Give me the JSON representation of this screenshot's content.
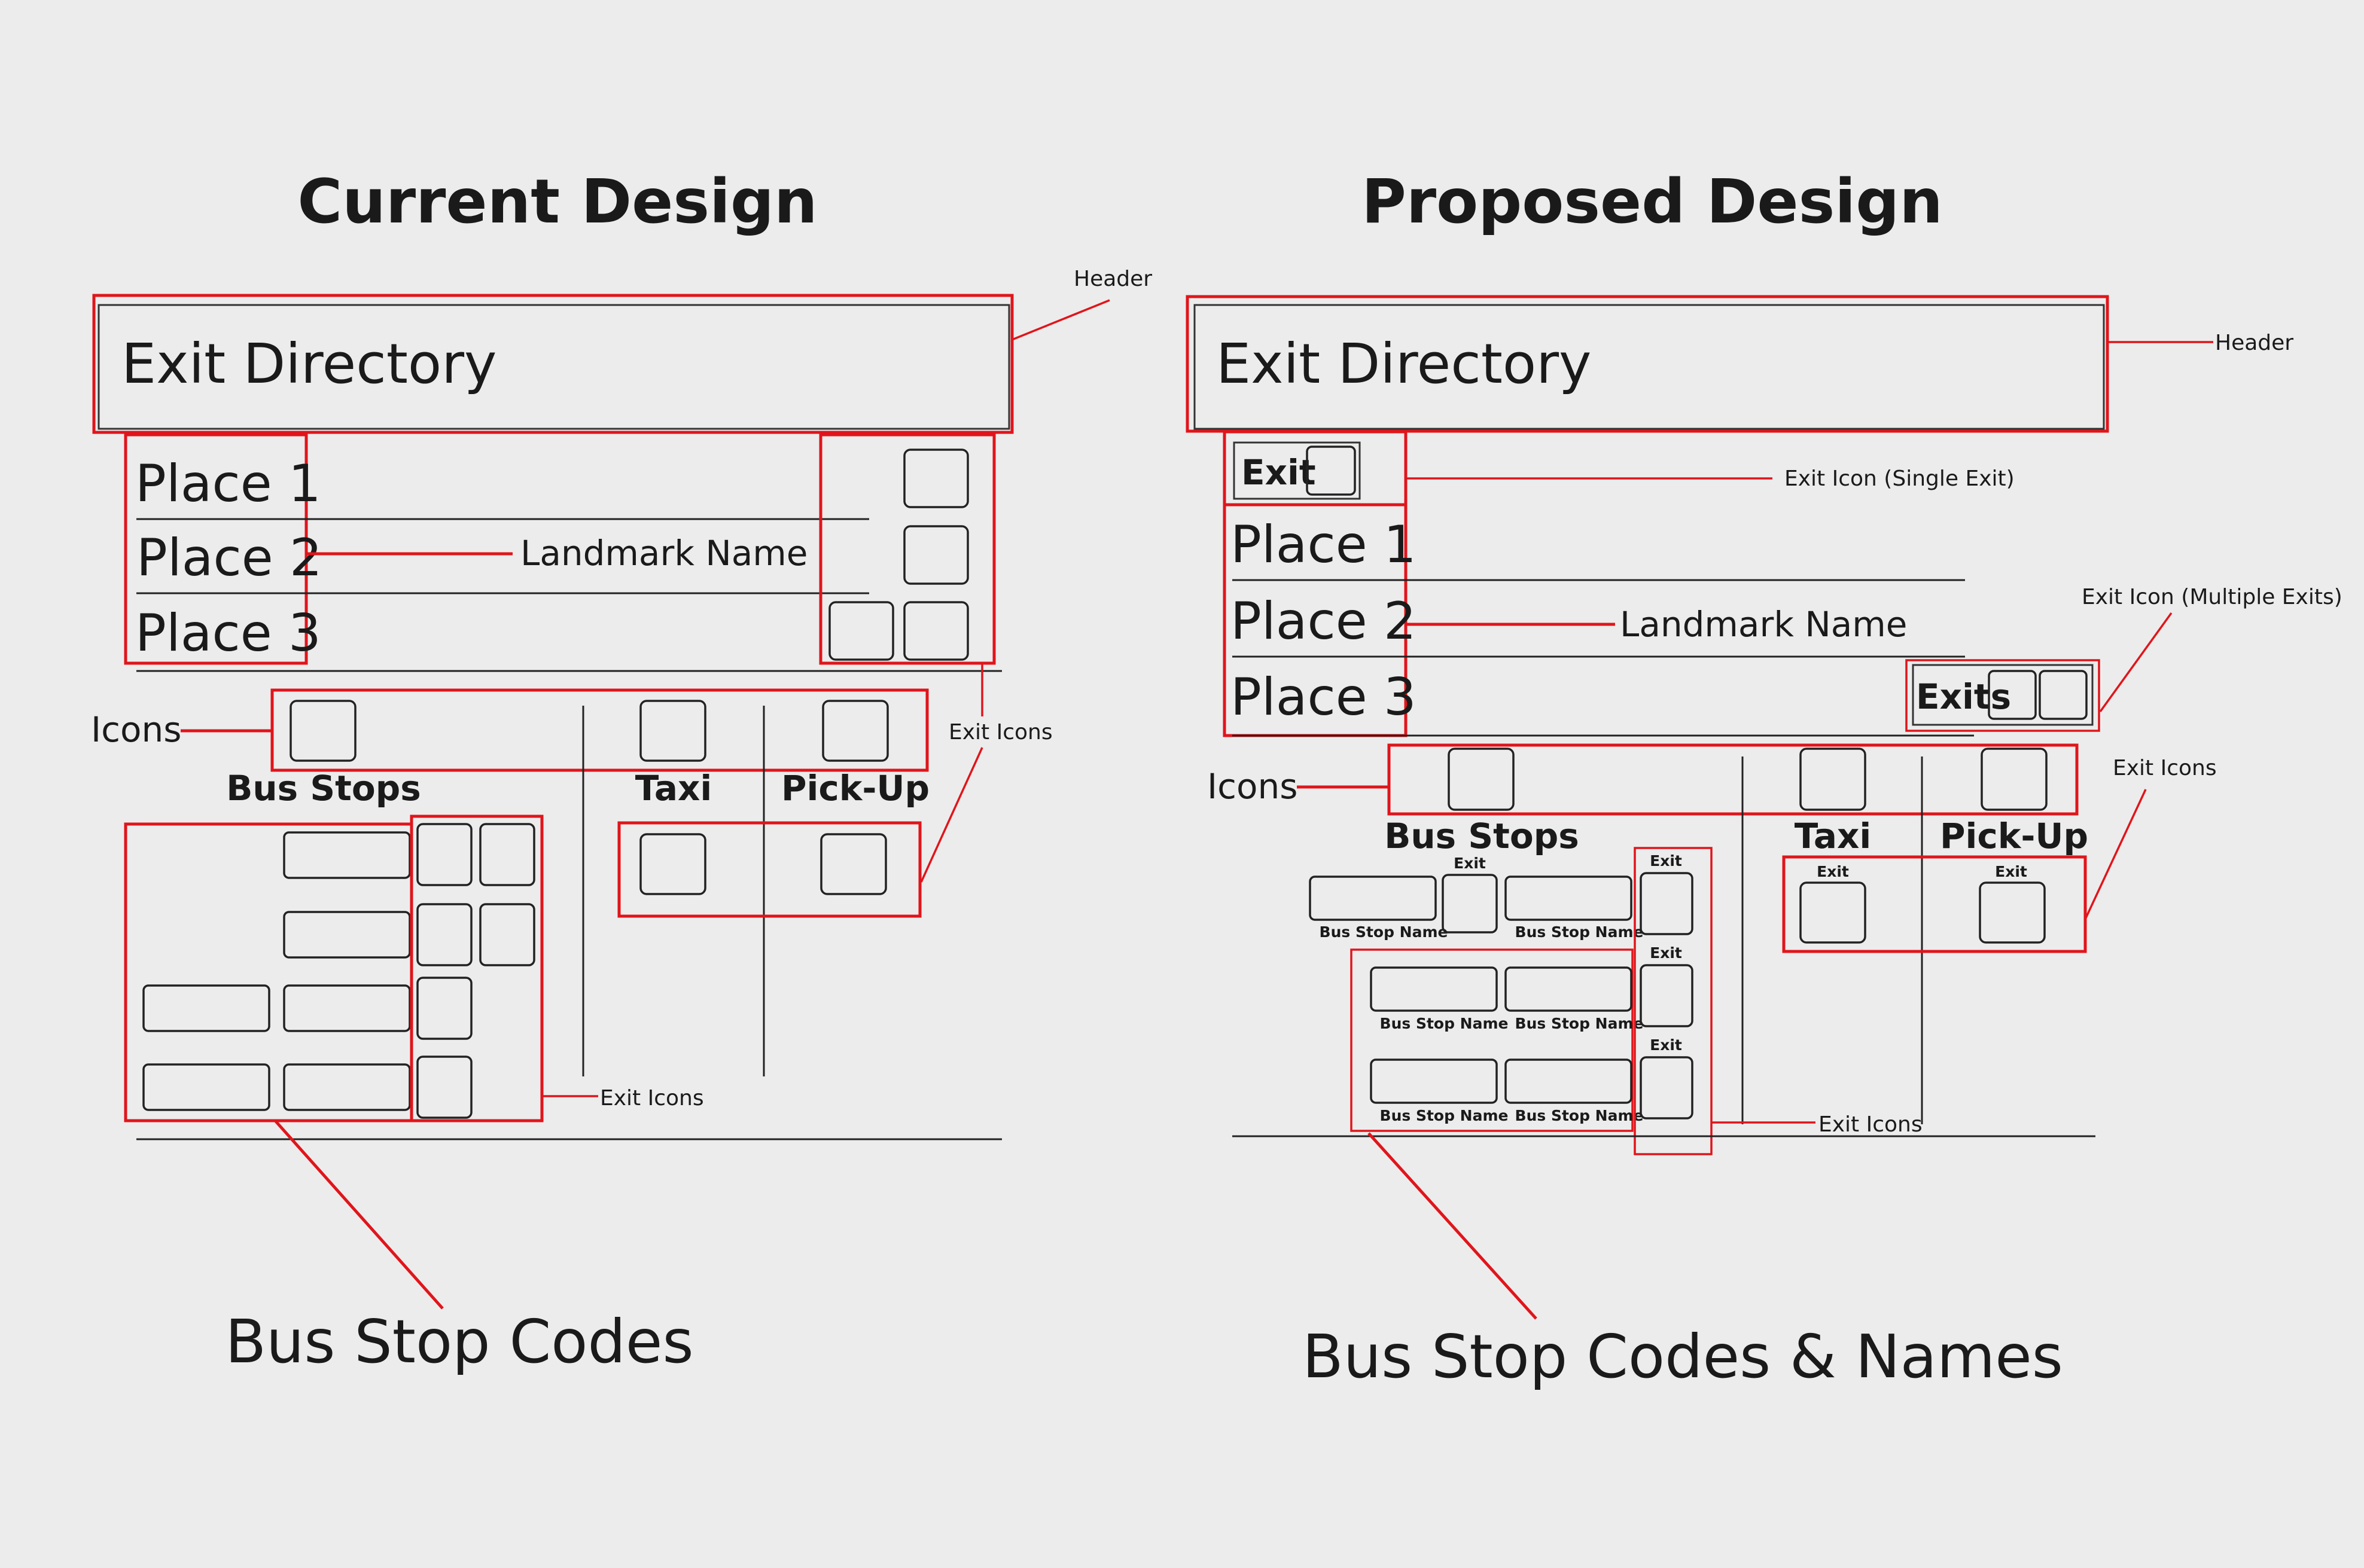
{
  "titles": {
    "current": "Current Design",
    "proposed": "Proposed Design"
  },
  "current": {
    "header_text": "Exit Directory",
    "places": [
      "Place 1",
      "Place 2",
      "Place 3"
    ],
    "landmark_label": "Landmark Name",
    "icons_label": "Icons",
    "categories": [
      "Bus Stops",
      "Taxi",
      "Pick-Up"
    ],
    "callout_header": "Header",
    "callout_exit_icons": "Exit Icons",
    "callout_exit_icons_bottom": "Exit Icons",
    "bottom_caption": "Bus Stop Codes"
  },
  "proposed": {
    "header_text": "Exit Directory",
    "exit_label": "Exit",
    "places": [
      "Place 1",
      "Place 2",
      "Place 3"
    ],
    "landmark_label": "Landmark Name",
    "exits_label": "Exits",
    "icons_label": "Icons",
    "categories": [
      "Bus Stops",
      "Taxi",
      "Pick-Up"
    ],
    "small_exit": "Exit",
    "bus_stop_name": "Bus Stop Name",
    "callout_header": "Header",
    "callout_single_exit": "Exit Icon (Single Exit)",
    "callout_multiple_exits": "Exit Icon (Multiple Exits)",
    "callout_exit_icons": "Exit Icons",
    "callout_exit_icons_bottom": "Exit Icons",
    "bottom_caption": "Bus Stop Codes & Names"
  },
  "colors": {
    "background": "#ececec",
    "annotation_red": "#e0151b",
    "ink": "#1a1a1a"
  }
}
